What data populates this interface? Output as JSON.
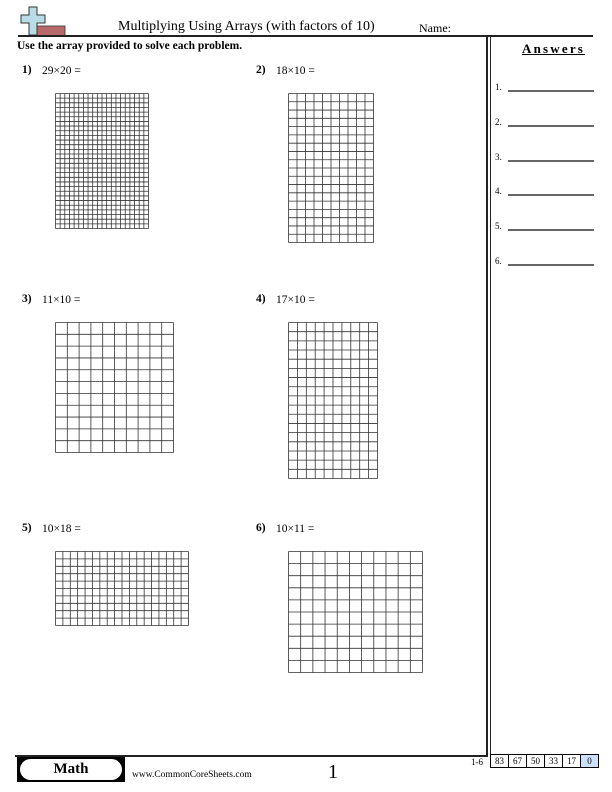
{
  "header": {
    "title": "Multiplying Using Arrays (with factors of 10)",
    "name_label": "Name:",
    "logo_icon": "plus-logo-icon"
  },
  "instructions": "Use the array provided to solve each problem.",
  "problems": [
    {
      "number": "1)",
      "text": "29×20 =",
      "rows": 29,
      "cols": 20
    },
    {
      "number": "2)",
      "text": "18×10 =",
      "rows": 18,
      "cols": 10
    },
    {
      "number": "3)",
      "text": "11×10 =",
      "rows": 11,
      "cols": 10
    },
    {
      "number": "4)",
      "text": "17×10 =",
      "rows": 17,
      "cols": 10
    },
    {
      "number": "5)",
      "text": "10×18 =",
      "rows": 10,
      "cols": 18
    },
    {
      "number": "6)",
      "text": "10×11 =",
      "rows": 10,
      "cols": 11
    }
  ],
  "answers": {
    "title": "Answers",
    "items": [
      "1.",
      "2.",
      "3.",
      "4.",
      "5.",
      "6."
    ]
  },
  "footer": {
    "subject": "Math",
    "site": "www.CommonCoreSheets.com",
    "page": "1",
    "range": "1-6",
    "scores": [
      "83",
      "67",
      "50",
      "33",
      "17",
      "0"
    ]
  },
  "colors": {
    "logo_cross": "#b8dce6",
    "logo_bar": "#b86a6a",
    "grid_line": "#333333",
    "grid_highlight": "#b0b0b0",
    "score_highlight": "#cce0ff"
  }
}
